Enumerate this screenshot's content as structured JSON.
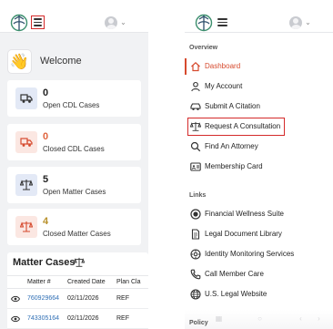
{
  "left": {
    "welcome": "Welcome",
    "cards": [
      {
        "count": "0",
        "label": "Open CDL Cases",
        "count_color": "#222222",
        "icon": "truck-icon"
      },
      {
        "count": "0",
        "label": "Closed CDL Cases",
        "count_color": "#e0653f",
        "icon": "truck-icon"
      },
      {
        "count": "5",
        "label": "Open Matter Cases",
        "count_color": "#222222",
        "icon": "scale-icon"
      },
      {
        "count": "4",
        "label": "Closed Matter Cases",
        "count_color": "#b8902a",
        "icon": "scale-icon"
      }
    ],
    "matter": {
      "title": "Matter Cases",
      "columns": [
        "Matter #",
        "Created Date",
        "Plan Cla"
      ],
      "rows": [
        {
          "id": "760929664",
          "date": "02/11/2026",
          "plan": "REF"
        },
        {
          "id": "743305164",
          "date": "02/11/2026",
          "plan": "REF"
        }
      ]
    }
  },
  "right": {
    "sections": {
      "overview": "Overview",
      "links": "Links",
      "policy": "Policy"
    },
    "nav": [
      {
        "label": "Dashboard",
        "icon": "home-icon",
        "active": true
      },
      {
        "label": "My Account",
        "icon": "user-icon"
      },
      {
        "label": "Submit A Citation",
        "icon": "car-icon"
      },
      {
        "label": "Request A Consultation",
        "icon": "scale-icon"
      },
      {
        "label": "Find An Attorney",
        "icon": "search-icon"
      },
      {
        "label": "Membership Card",
        "icon": "id-card-icon"
      }
    ],
    "links": [
      {
        "label": "Financial Wellness Suite",
        "icon": "disc-icon"
      },
      {
        "label": "Legal Document Library",
        "icon": "document-icon"
      },
      {
        "label": "Identity Monitoring Services",
        "icon": "shield-icon"
      },
      {
        "label": "Call Member Care",
        "icon": "phone-icon"
      },
      {
        "label": "U.S. Legal Website",
        "icon": "globe-icon"
      }
    ]
  },
  "colors": {
    "accent": "#d64a2e",
    "highlight": "#d42a2a",
    "link": "#2f6fb5",
    "brand_green": "#3c8f6e"
  }
}
